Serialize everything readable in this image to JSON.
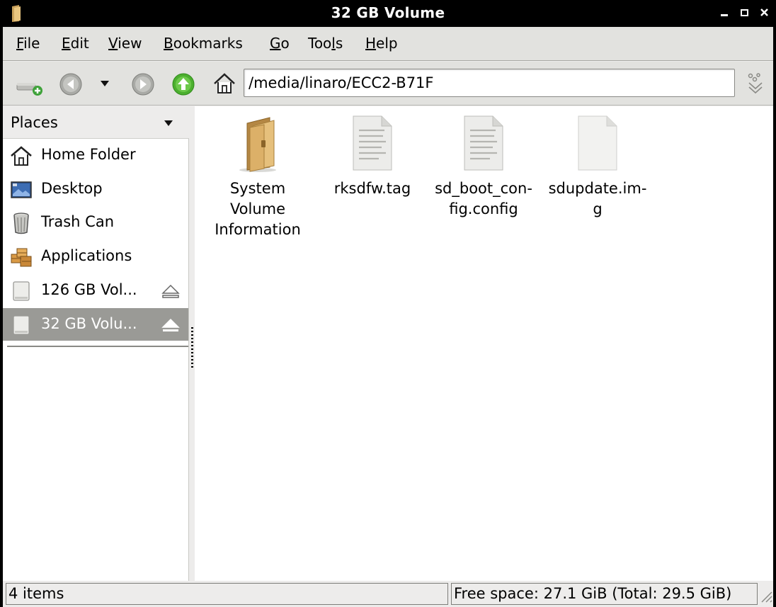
{
  "window": {
    "title": "32 GB Volume"
  },
  "menu": [
    {
      "pre": "",
      "mn": "F",
      "post": "ile"
    },
    {
      "pre": "",
      "mn": "E",
      "post": "dit"
    },
    {
      "pre": "",
      "mn": "V",
      "post": "iew"
    },
    {
      "pre": "",
      "mn": "B",
      "post": "ookmarks"
    },
    {
      "pre": "",
      "mn": "G",
      "post": "o"
    },
    {
      "pre": "Too",
      "mn": "l",
      "post": "s"
    },
    {
      "pre": "",
      "mn": "H",
      "post": "elp"
    }
  ],
  "toolbar": {
    "location": "/media/linaro/ECC2-B71F",
    "icons": [
      "new-tab-icon",
      "back-icon",
      "history-dropdown-icon",
      "forward-icon",
      "up-icon",
      "home-icon",
      "location-bar-icon"
    ]
  },
  "sidebar": {
    "header": "Places",
    "items": [
      {
        "label": "Home Folder",
        "icon": "home-folder-icon"
      },
      {
        "label": "Desktop",
        "icon": "desktop-icon"
      },
      {
        "label": "Trash Can",
        "icon": "trash-can-icon"
      },
      {
        "label": "Applications",
        "icon": "applications-icon"
      },
      {
        "label": "126 GB Vol...",
        "icon": "drive-icon",
        "eject": true
      },
      {
        "label": "32 GB Volu...",
        "icon": "drive-icon",
        "eject": true,
        "selected": true
      }
    ]
  },
  "files": [
    {
      "line1": "System",
      "line2": "Volume",
      "line3": "Information",
      "icon": "folder-icon"
    },
    {
      "line1": "rksdfw.tag",
      "line2": "",
      "line3": "",
      "icon": "text-file-icon"
    },
    {
      "line1": "sd_boot_con-",
      "line2": "fig.config",
      "line3": "",
      "icon": "text-file-icon"
    },
    {
      "line1": "sdupdate.im-",
      "line2": "g",
      "line3": "",
      "icon": "blank-file-icon"
    }
  ],
  "status": {
    "items": "4 items",
    "space": "Free space: 27.1 GiB (Total: 29.5 GiB)"
  }
}
